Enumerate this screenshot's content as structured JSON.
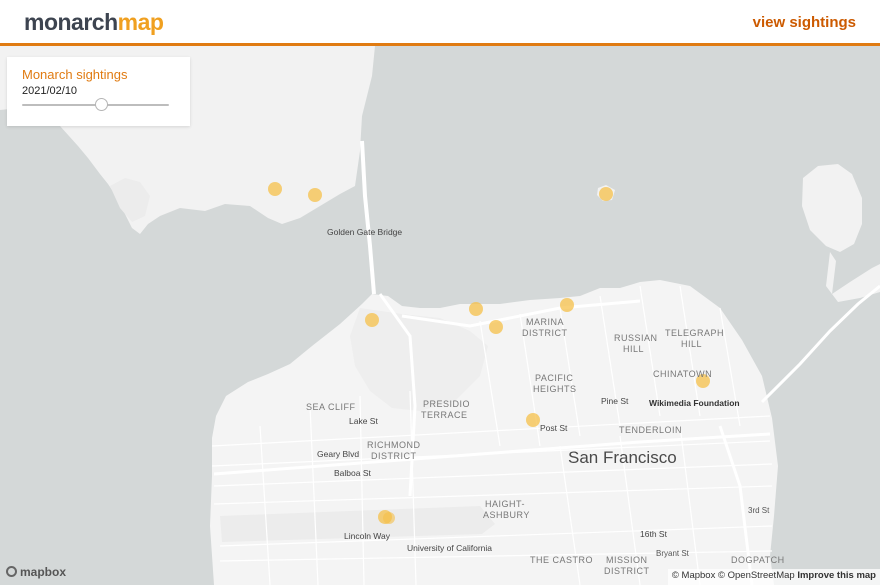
{
  "header": {
    "logo_part1": "monarch",
    "logo_part2": "map",
    "nav_link": "view sightings"
  },
  "panel": {
    "title": "Monarch sightings",
    "date": "2021/02/10",
    "slider_level": 0.54
  },
  "map_labels": [
    {
      "id": "golden-gate-bridge",
      "text": "Golden Gate Bridge"
    },
    {
      "id": "marina-district-1",
      "text": "MARINA"
    },
    {
      "id": "marina-district-2",
      "text": "DISTRICT"
    },
    {
      "id": "russian-hill-1",
      "text": "RUSSIAN"
    },
    {
      "id": "russian-hill-2",
      "text": "HILL"
    },
    {
      "id": "telegraph-hill-1",
      "text": "TELEGRAPH"
    },
    {
      "id": "telegraph-hill-2",
      "text": "HILL"
    },
    {
      "id": "pacific-heights-1",
      "text": "PACIFIC"
    },
    {
      "id": "pacific-heights-2",
      "text": "HEIGHTS"
    },
    {
      "id": "chinatown",
      "text": "CHINATOWN"
    },
    {
      "id": "sea-cliff",
      "text": "SEA CLIFF"
    },
    {
      "id": "presidio-terrace-1",
      "text": "PRESIDIO"
    },
    {
      "id": "presidio-terrace-2",
      "text": "TERRACE"
    },
    {
      "id": "lake-st",
      "text": "Lake St"
    },
    {
      "id": "pine-st",
      "text": "Pine St"
    },
    {
      "id": "wikimedia",
      "text": "Wikimedia Foundation"
    },
    {
      "id": "richmond-1",
      "text": "RICHMOND"
    },
    {
      "id": "richmond-2",
      "text": "DISTRICT"
    },
    {
      "id": "post-st",
      "text": "Post St"
    },
    {
      "id": "tenderloin",
      "text": "TENDERLOIN"
    },
    {
      "id": "geary-blvd",
      "text": "Geary Blvd"
    },
    {
      "id": "san-francisco",
      "text": "San Francisco"
    },
    {
      "id": "balboa-st",
      "text": "Balboa St"
    },
    {
      "id": "haight-ashbury-1",
      "text": "HAIGHT-"
    },
    {
      "id": "haight-ashbury-2",
      "text": "ASHBURY"
    },
    {
      "id": "lincoln-way",
      "text": "Lincoln Way"
    },
    {
      "id": "16th-st",
      "text": "16th St"
    },
    {
      "id": "3rd-st",
      "text": "3rd St"
    },
    {
      "id": "univ-california",
      "text": "University of California"
    },
    {
      "id": "the-castro",
      "text": "THE CASTRO"
    },
    {
      "id": "mission-1",
      "text": "MISSION"
    },
    {
      "id": "mission-2",
      "text": "DISTRICT"
    },
    {
      "id": "dogpatch",
      "text": "DOGPATCH"
    },
    {
      "id": "bryant-st",
      "text": "Bryant St"
    }
  ],
  "sightings_count": 11,
  "attribution": {
    "mapbox": "© Mapbox",
    "osm": "© OpenStreetMap",
    "improve": "Improve this map",
    "logo": "mapbox"
  },
  "colors": {
    "water": "#d4d8d8",
    "land": "#f4f4f4",
    "accent": "#e07b12",
    "sighting": "#f5c04a"
  }
}
